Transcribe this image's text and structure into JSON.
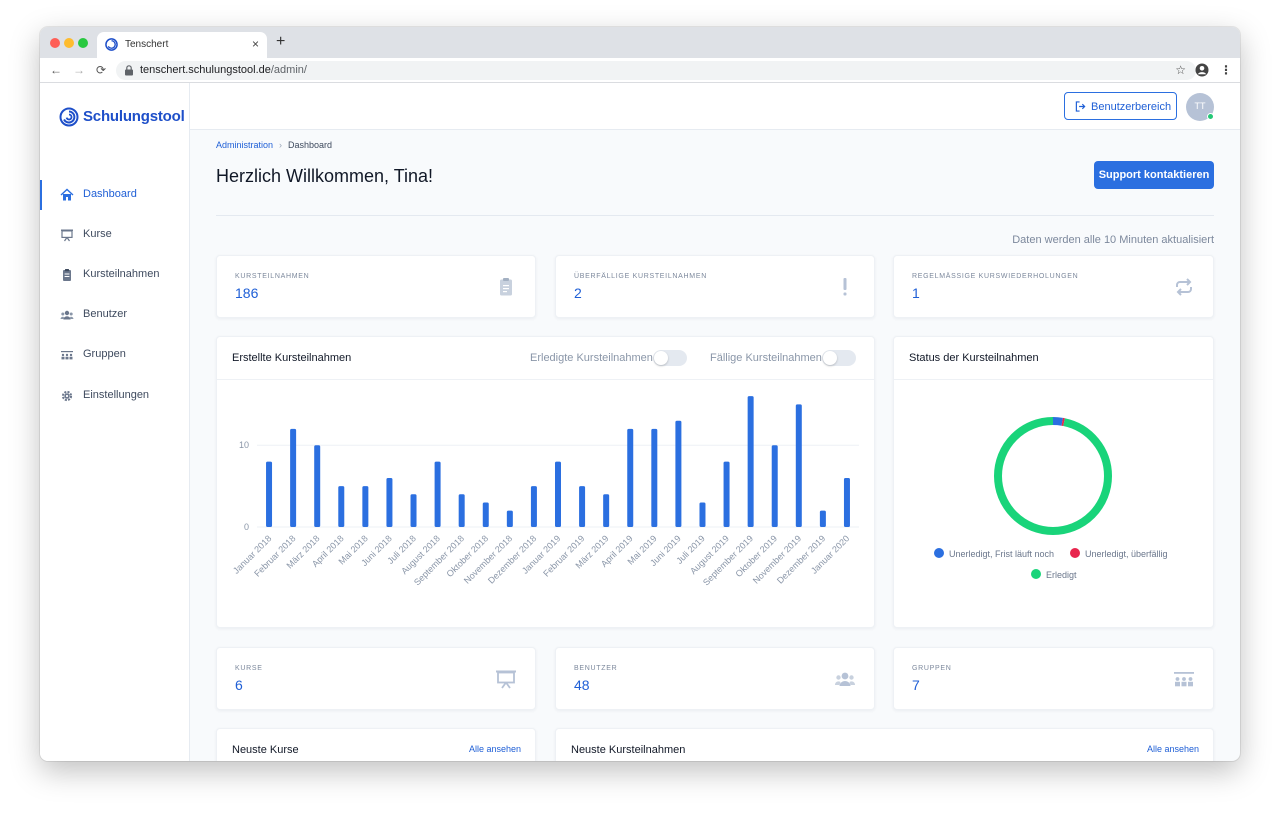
{
  "browser": {
    "tab_title": "Tenschert",
    "tab_close": "×",
    "new_tab": "+",
    "url_host": "tenschert.schulungstool.de",
    "url_path": "/admin/",
    "back": "←",
    "forward": "→",
    "reload": "⟳",
    "bookmark": "☆",
    "menu": "⋮"
  },
  "sidebar": {
    "logo_text": "Schulungstool",
    "items": [
      {
        "label": "Dashboard",
        "icon": "home-icon",
        "active": true
      },
      {
        "label": "Kurse",
        "icon": "presentation-icon",
        "active": false
      },
      {
        "label": "Kursteilnahmen",
        "icon": "clipboard-icon",
        "active": false
      },
      {
        "label": "Benutzer",
        "icon": "users-icon",
        "active": false
      },
      {
        "label": "Gruppen",
        "icon": "groups-icon",
        "active": false
      },
      {
        "label": "Einstellungen",
        "icon": "gear-icon",
        "active": false
      }
    ]
  },
  "header": {
    "user_area_label": "Benutzerbereich",
    "avatar_initials": "TT"
  },
  "breadcrumb": {
    "root": "Administration",
    "separator": "›",
    "current": "Dashboard"
  },
  "page": {
    "title": "Herzlich Willkommen, Tina!",
    "support_label": "Support kontaktieren",
    "refresh_note": "Daten werden alle 10 Minuten aktualisiert"
  },
  "stats_top": [
    {
      "label": "Kursteilnahmen",
      "value": "186",
      "icon": "clipboard-icon"
    },
    {
      "label": "Überfällige Kursteilnahmen",
      "value": "2",
      "icon": "exclamation-icon"
    },
    {
      "label": "Regelmässige Kurswiederholungen",
      "value": "1",
      "icon": "repeat-icon"
    }
  ],
  "stats_bottom": [
    {
      "label": "Kurse",
      "value": "6",
      "icon": "presentation-icon"
    },
    {
      "label": "Benutzer",
      "value": "48",
      "icon": "users-icon"
    },
    {
      "label": "Gruppen",
      "value": "7",
      "icon": "groups-icon"
    }
  ],
  "bar_card": {
    "title": "Erstellte Kursteilnahmen",
    "toggle_done": "Erledigte Kursteilnahmen",
    "toggle_due": "Fällige Kursteilnahmen"
  },
  "donut_card": {
    "title": "Status der Kursteilnahmen",
    "legend": [
      {
        "label": "Unerledigt, Frist läuft noch",
        "color": "#2b6fe0"
      },
      {
        "label": "Unerledigt, überfällig",
        "color": "#e8254d"
      },
      {
        "label": "Erledigt",
        "color": "#19d47a"
      }
    ]
  },
  "lists": {
    "courses_title": "Neuste Kurse",
    "courses_see_all": "Alle ansehen",
    "enrollments_title": "Neuste Kursteilnahmen",
    "enrollments_see_all": "Alle ansehen"
  },
  "colors": {
    "accent": "#2b6fe0",
    "done": "#19d47a",
    "overdue": "#e8254d"
  },
  "chart_data": [
    {
      "type": "bar",
      "categories": [
        "Januar 2018",
        "Februar 2018",
        "März 2018",
        "April 2018",
        "Mai 2018",
        "Juni 2018",
        "Juli 2018",
        "August 2018",
        "September 2018",
        "Oktober 2018",
        "November 2018",
        "Dezember 2018",
        "Januar 2019",
        "Februar 2019",
        "März 2019",
        "April 2019",
        "Mai 2019",
        "Juni 2019",
        "Juli 2019",
        "August 2019",
        "September 2019",
        "Oktober 2019",
        "November 2019",
        "Dezember 2019",
        "Januar 2020"
      ],
      "values": [
        8,
        12,
        10,
        5,
        5,
        6,
        4,
        8,
        4,
        3,
        2,
        5,
        8,
        5,
        4,
        12,
        12,
        13,
        3,
        8,
        16,
        10,
        15,
        2,
        6
      ],
      "y_ticks": [
        0,
        10
      ],
      "ylim": [
        0,
        17
      ],
      "grid": true,
      "color": "#2b6fe0"
    },
    {
      "type": "pie",
      "variant": "donut",
      "categories": [
        "Unerledigt, Frist läuft noch",
        "Unerledigt, überfällig",
        "Erledigt"
      ],
      "values": [
        5,
        1,
        180
      ],
      "colors": [
        "#2b6fe0",
        "#e8254d",
        "#19d47a"
      ],
      "legend": "bottom"
    }
  ]
}
